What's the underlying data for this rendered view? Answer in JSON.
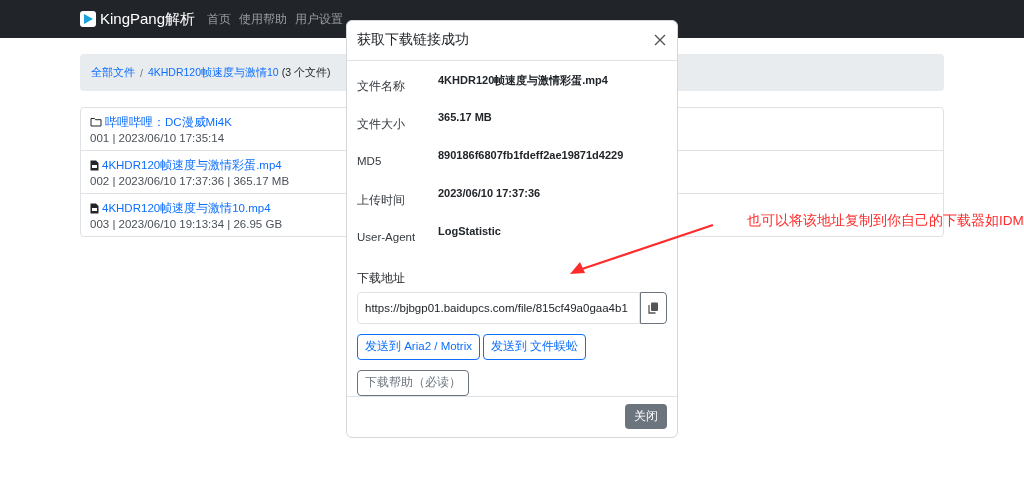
{
  "navbar": {
    "brand": "KingPang解析",
    "links": [
      {
        "label": "首页"
      },
      {
        "label": "使用帮助"
      },
      {
        "label": "用户设置"
      }
    ]
  },
  "breadcrumb": {
    "items": [
      {
        "label": "全部文件"
      },
      {
        "label": "4KHDR120帧速度与激情10"
      }
    ],
    "separator": "/",
    "count": "(3 个文件)"
  },
  "files": [
    {
      "kind": "folder",
      "name": "哔哩哔哩：DC漫威Mi4K",
      "meta": "001 | 2023/06/10 17:35:14"
    },
    {
      "kind": "file",
      "name": "4KHDR120帧速度与激情彩蛋.mp4",
      "meta": "002 | 2023/06/10 17:37:36 | 365.17 MB"
    },
    {
      "kind": "file",
      "name": "4KHDR120帧速度与激情10.mp4",
      "meta": "003 | 2023/06/10 19:13:34 | 26.95 GB"
    }
  ],
  "modal": {
    "title": "获取下载链接成功",
    "fields": [
      {
        "label": "文件名称",
        "value": "4KHDR120帧速度与激情彩蛋.mp4"
      },
      {
        "label": "文件大小",
        "value": "365.17 MB"
      },
      {
        "label": "MD5",
        "value": "890186f6807fb1fdeff2ae19871d4229"
      },
      {
        "label": "上传时间",
        "value": "2023/06/10 17:37:36"
      },
      {
        "label": "User-Agent",
        "value": "LogStatistic"
      }
    ],
    "url_label": "下载地址",
    "url": "https://bjbgp01.baidupcs.com/file/815cf49a0gaa4b1",
    "send_buttons": [
      {
        "label": "发送到 Aria2 / Motrix"
      },
      {
        "label": "发送到 文件蜈蚣"
      }
    ],
    "help_button": "下载帮助（必读）",
    "close_button": "关闭"
  },
  "annotation": {
    "text": "也可以将该地址复制到你自己的下载器如IDM"
  }
}
